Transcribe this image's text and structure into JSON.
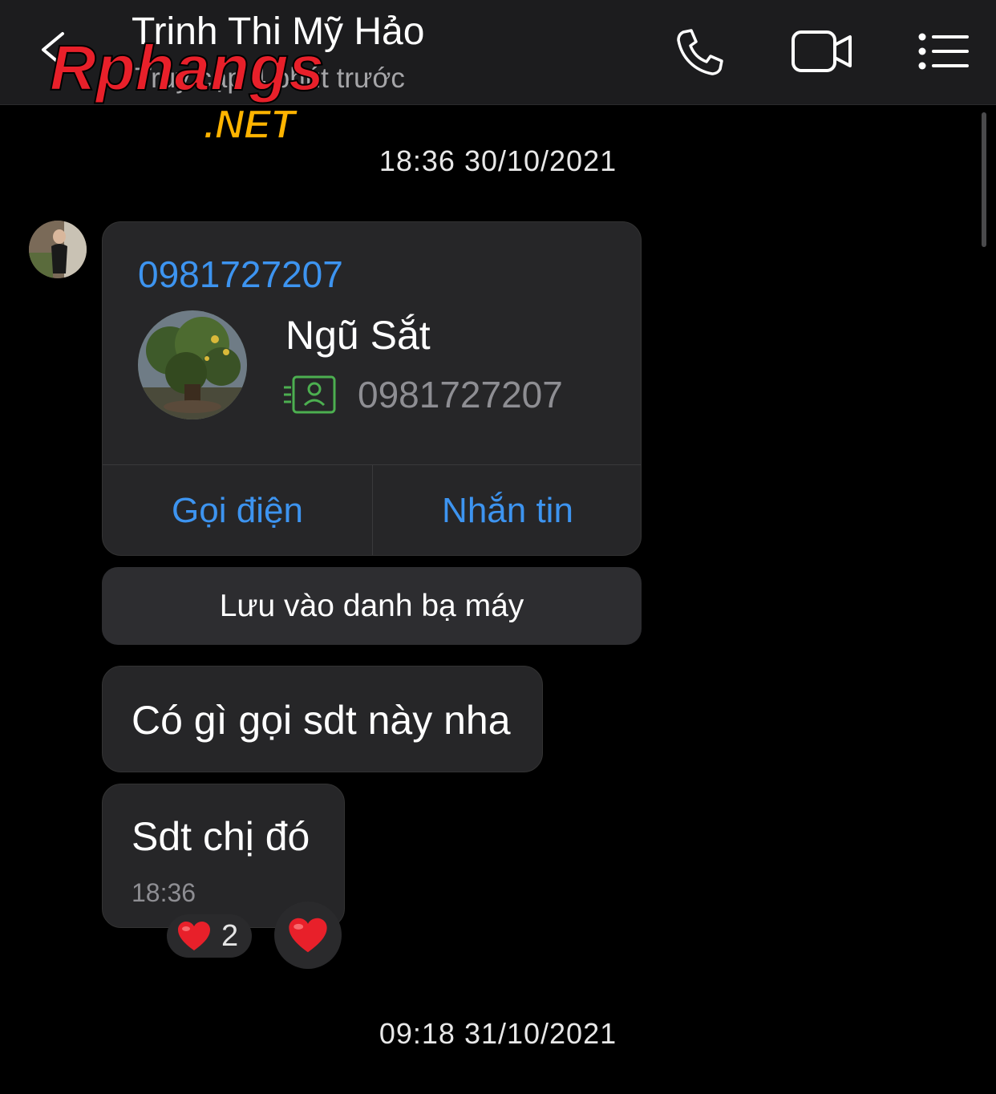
{
  "header": {
    "title": "Trinh Thi Mỹ Hảo",
    "subtitle": "Truy cập 4 phút trước",
    "icons": [
      "back-chevron-icon",
      "phone-call-icon",
      "video-call-icon",
      "menu-list-icon"
    ]
  },
  "watermark": {
    "brand": "Rphangs",
    "suffix": ".NET"
  },
  "dates": {
    "first": "18:36 30/10/2021",
    "second": "09:18 31/10/2021"
  },
  "contact_card": {
    "phone_link": "0981727207",
    "name": "Ngũ Sắt",
    "phone": "0981727207",
    "call_label": "Gọi điện",
    "message_label": "Nhắn tin"
  },
  "save_contact_label": "Lưu vào danh bạ máy",
  "messages": [
    {
      "text": "Có gì gọi sdt này nha"
    },
    {
      "text": "Sdt chị đó",
      "time": "18:36"
    }
  ],
  "reactions": {
    "count": "2",
    "icon": "red-heart-icon"
  },
  "colors": {
    "accent": "#3d94f0",
    "bubble": "#262628",
    "header": "#1c1c1e",
    "id_icon": "#4caf50"
  }
}
